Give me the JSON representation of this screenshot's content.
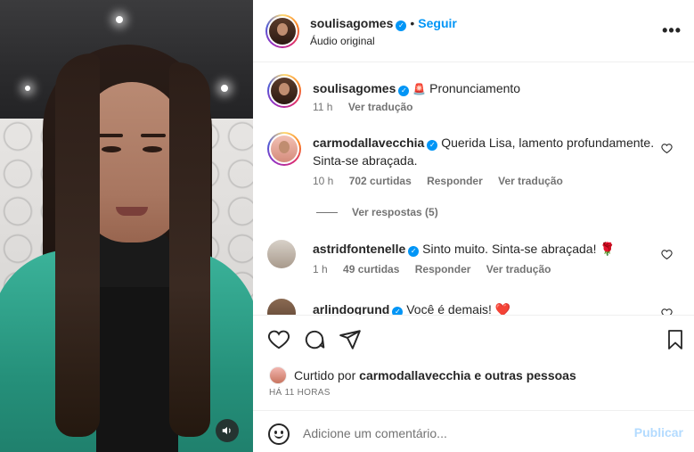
{
  "post": {
    "author": "soulisagomes",
    "follow_label": "Seguir",
    "audio_label": "Áudio original",
    "dot": "•",
    "more_label": "•••"
  },
  "caption": {
    "author": "soulisagomes",
    "emoji": "🚨",
    "text": "Pronunciamento",
    "time": "11 h",
    "translate": "Ver tradução"
  },
  "comments": [
    {
      "author": "carmodallavecchia",
      "text": "Querida Lisa, lamento profundamente. Sinta-se abraçada.",
      "time": "10 h",
      "likes": "702 curtidas",
      "reply": "Responder",
      "translate": "Ver tradução",
      "view_replies": "Ver respostas (5)"
    },
    {
      "author": "astridfontenelle",
      "text": "Sinto muito. Sinta-se abraçada! 🌹",
      "time": "1 h",
      "likes": "49 curtidas",
      "reply": "Responder",
      "translate": "Ver tradução"
    },
    {
      "author": "arlindogrund",
      "text": "Você é demais! ❤️"
    }
  ],
  "likes": {
    "prefix": "Curtido por",
    "user": "carmodallavecchia",
    "suffix": "e outras pessoas"
  },
  "timestamp": "HÁ 11 HORAS",
  "comment_box": {
    "placeholder": "Adicione um comentário...",
    "publish_label": "Publicar"
  },
  "icons": [
    "heart-icon",
    "comment-icon",
    "share-icon",
    "bookmark-icon",
    "emoji-icon",
    "sound-icon",
    "more-icon",
    "verified-icon"
  ],
  "colors": {
    "accent": "#0095f6",
    "muted": "#737373",
    "publish_disabled": "#b3dbff"
  }
}
